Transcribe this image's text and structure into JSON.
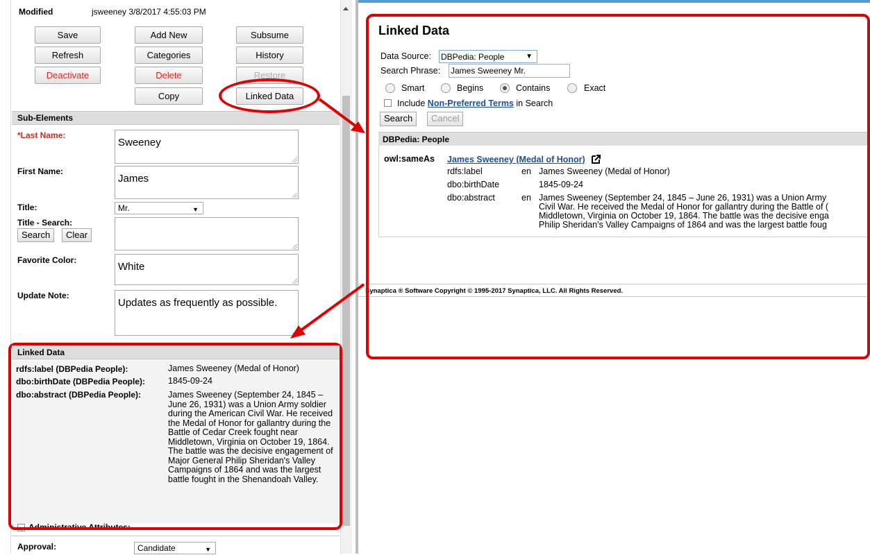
{
  "modified": {
    "label": "Modified",
    "value": "jsweeney 3/8/2017 4:55:03 PM"
  },
  "buttons": {
    "save": "Save",
    "add_new": "Add New",
    "subsume": "Subsume",
    "refresh": "Refresh",
    "categories": "Categories",
    "history": "History",
    "deactivate": "Deactivate",
    "delete": "Delete",
    "restore": "Restore",
    "copy": "Copy",
    "linked_data": "Linked Data"
  },
  "sub_elements": {
    "header": "Sub-Elements",
    "last_name": {
      "label": "*Last Name:",
      "value": "Sweeney"
    },
    "first_name": {
      "label": "First Name:",
      "value": "James"
    },
    "title": {
      "label": "Title:",
      "value": "Mr."
    },
    "title_search": {
      "label": "Title - Search:",
      "search_btn": "Search",
      "clear_btn": "Clear",
      "value": ""
    },
    "favorite_color": {
      "label": "Favorite Color:",
      "value": "White"
    },
    "update_note": {
      "label": "Update Note:",
      "value": "Updates as frequently as possible."
    }
  },
  "linked_data_section": {
    "header": "Linked Data",
    "rows": [
      {
        "key": "rdfs:label (DBPedia People):",
        "value": "James Sweeney (Medal of Honor)"
      },
      {
        "key": "dbo:birthDate (DBPedia People):",
        "value": "1845-09-24"
      },
      {
        "key": "dbo:abstract (DBPedia People):",
        "value": "James Sweeney (September 24, 1845 – June 26, 1931) was a Union Army soldier during the American Civil War. He received the Medal of Honor for gallantry during the Battle of Cedar Creek fought near Middletown, Virginia on October 19, 1864. The battle was the decisive engagement of Major General Philip Sheridan's Valley Campaigns of 1864 and was the largest battle fought in the Shenandoah Valley."
      }
    ]
  },
  "admin": {
    "label": "Administrative Attributes:"
  },
  "approval": {
    "label": "Approval:",
    "value": "Candidate"
  },
  "right": {
    "title": "Linked Data",
    "data_source_label": "Data Source:",
    "data_source_value": "DBPedia: People",
    "search_phrase_label": "Search Phrase:",
    "search_phrase_value": "James Sweeney Mr.",
    "radios": [
      "Smart",
      "Begins",
      "Contains",
      "Exact"
    ],
    "selected_radio": "Contains",
    "include_prefix": "Include",
    "include_link": "Non-Preferred Terms",
    "include_suffix": "in Search",
    "search_btn": "Search",
    "cancel_btn": "Cancel",
    "result_header": "DBPedia: People",
    "same_as_key": "owl:sameAs",
    "same_as_link": "James Sweeney (Medal of Honor)",
    "results": [
      {
        "prop": "rdfs:label",
        "lang": "en",
        "value": "James Sweeney (Medal of Honor)"
      },
      {
        "prop": "dbo:birthDate",
        "lang": "",
        "value": "1845-09-24"
      },
      {
        "prop": "dbo:abstract",
        "lang": "en",
        "lines": [
          "James Sweeney (September 24, 1845 – June 26, 1931) was a Union Army",
          "Civil War. He received the Medal of Honor for gallantry during the Battle of (",
          "Middletown, Virginia on October 19, 1864. The battle was the decisive enga",
          "Philip Sheridan's Valley Campaigns of 1864 and was the largest battle foug"
        ]
      }
    ],
    "footer": "Synaptica ® Software Copyright © 1995-2017 Synaptica, LLC. All Rights Reserved."
  }
}
